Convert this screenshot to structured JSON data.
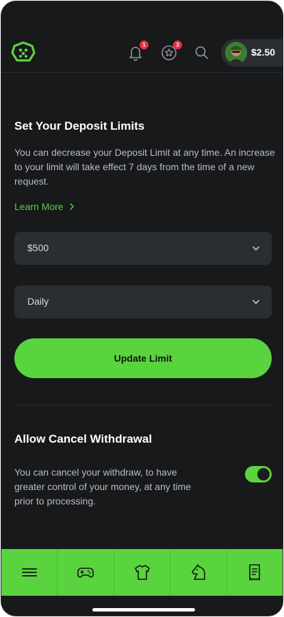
{
  "header": {
    "logo_icon": "dice-shield-logo-icon",
    "notifications": {
      "icon": "bell-icon",
      "badge": "1"
    },
    "rewards": {
      "icon": "star-icon",
      "badge": "3"
    },
    "search_icon": "search-icon",
    "wallet": {
      "balance": "$2.50",
      "avatar": "avatar"
    }
  },
  "deposit_limits": {
    "title": "Set Your Deposit Limits",
    "description": "You can decrease your Deposit Limit at any time. An increase to your limit will take effect 7 days from the time of a new request.",
    "learn_more": "Learn More",
    "amount_select": "$500",
    "period_select": "Daily",
    "update_button": "Update Limit"
  },
  "cancel_withdrawal": {
    "title": "Allow Cancel Withdrawal",
    "description": "You can cancel your withdraw, to have greater control of your money, at any time prior to processing.",
    "toggle_on": true
  },
  "bottom_nav": {
    "items": [
      "menu-icon",
      "gamepad-icon",
      "jersey-icon",
      "horse-icon",
      "receipt-icon"
    ]
  },
  "colors": {
    "accent": "#59d43f",
    "background": "#17191b",
    "field": "#2b2e31",
    "badge": "#e8313d"
  }
}
